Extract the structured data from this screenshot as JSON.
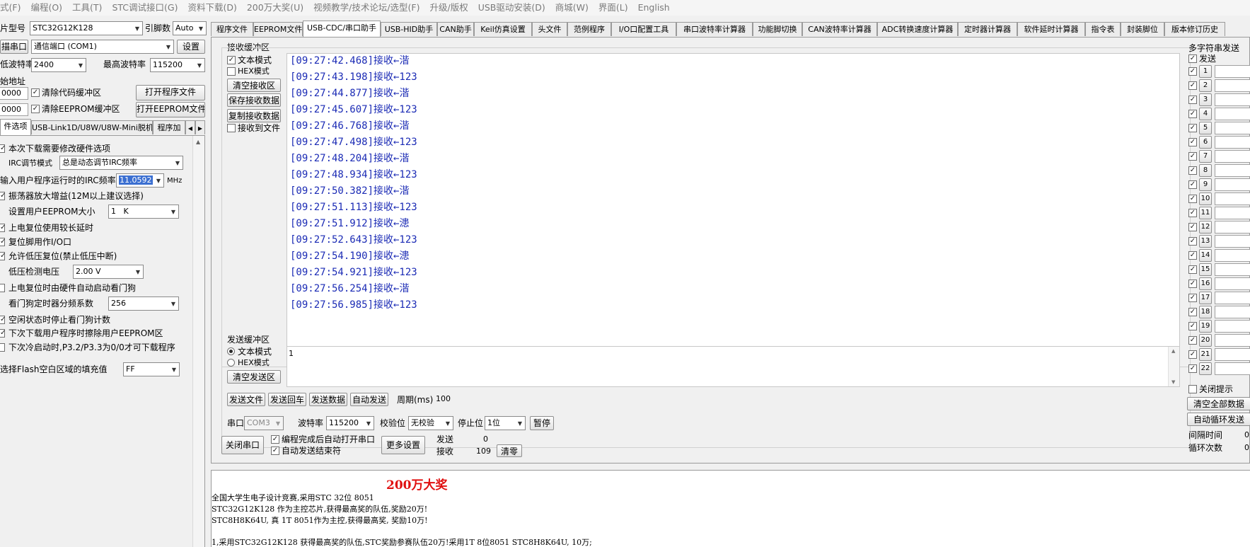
{
  "menu": [
    "式(F)",
    "编程(O)",
    "工具(T)",
    "STC调试接口(G)",
    "资料下载(D)",
    "200万大奖(U)",
    "视频教学/技术论坛/选型(F)",
    "升级/版权",
    "USB驱动安装(D)",
    "商城(W)",
    "界面(L)",
    "English"
  ],
  "left": {
    "chip_label": "片型号",
    "chip_value": "STC32G12K128",
    "pins_label": "引脚数",
    "pins_value": "Auto",
    "port_button": "描串口",
    "port_value": "通信端口 (COM1)",
    "settings_button": "设置",
    "min_baud_label": "低波特率",
    "min_baud_value": "2400",
    "max_baud_label": "最高波特率",
    "max_baud_value": "115200",
    "start_addr_label": "始地址",
    "addr1_value": "0000",
    "clear_code_label": "清除代码缓冲区",
    "open_program_button": "打开程序文件",
    "addr2_value": "0000",
    "clear_eeprom_label": "清除EEPROM缓冲区",
    "open_eeprom_button": "打开EEPROM文件",
    "tabs": [
      "件选项",
      "USB-Link1D/U8W/U8W-Mini脱机",
      "程序加"
    ],
    "hw": {
      "opt1": "本次下载需要修改硬件选项",
      "irc_mode_label": "IRC调节模式",
      "irc_mode_value": "总是动态调节IRC频率",
      "irc_freq_label": "输入用户程序运行时的IRC频率",
      "irc_freq_value": "11.0592",
      "irc_freq_unit": "MHz",
      "osc_gain": "振荡器放大增益(12M以上建议选择)",
      "eeprom_size_label": "设置用户EEPROM大小",
      "eeprom_size_value": "1   K",
      "opt_long_delay": "上电复位使用较长延时",
      "opt_reset_io": "复位脚用作I/O口",
      "opt_lvr": "允许低压复位(禁止低压中断)",
      "lvd_label": "低压检测电压",
      "lvd_value": "2.00 V",
      "opt_wdt_hw": "上电复位时由硬件自动启动看门狗",
      "wdt_div_label": "看门狗定时器分频系数",
      "wdt_div_value": "256",
      "opt_idle_wdt": "空闲状态时停止看门狗计数",
      "opt_erase_eeprom": "下次下载用户程序时擦除用户EEPROM区",
      "opt_cold_boot": "下次冷启动时,P3.2/P3.3为0/0才可下载程序",
      "flash_fill_label": "选择Flash空白区域的填充值",
      "flash_fill_value": "FF"
    }
  },
  "main_tabs": [
    "程序文件",
    "EEPROM文件",
    "USB-CDC/串口助手",
    "USB-HID助手",
    "CAN助手",
    "Keil仿真设置",
    "头文件",
    "范例程序",
    "I/O口配置工具",
    "串口波特率计算器",
    "功能脚切换",
    "CAN波特率计算器",
    "ADC转换速度计算器",
    "定时器计算器",
    "软件延时计算器",
    "指令表",
    "封装脚位",
    "版本修订历史"
  ],
  "recv": {
    "title": "接收缓冲区",
    "text_mode": "文本模式",
    "hex_mode": "HEX模式",
    "clear_button": "清空接收区",
    "save_button": "保存接收数据",
    "copy_button": "复制接收数据",
    "to_file": "接收到文件",
    "lines": [
      "[09:27:42.468]接收←湝",
      "[09:27:43.198]接收←123",
      "[09:27:44.877]接收←湝",
      "[09:27:45.607]接收←123",
      "[09:27:46.768]接收←湝",
      "[09:27:47.498]接收←123",
      "[09:27:48.204]接收←湝",
      "[09:27:48.934]接收←123",
      "[09:27:50.382]接收←湝",
      "[09:27:51.113]接收←123",
      "[09:27:51.912]接收←漶",
      "[09:27:52.643]接收←123",
      "[09:27:54.190]接收←漶",
      "[09:27:54.921]接收←123",
      "[09:27:56.254]接收←湝",
      "[09:27:56.985]接收←123"
    ]
  },
  "send": {
    "title": "发送缓冲区",
    "text_mode": "文本模式",
    "hex_mode": "HEX模式",
    "clear_button": "清空发送区",
    "content": "1",
    "send_file_button": "发送文件",
    "send_return_button": "发送回车",
    "send_data_button": "发送数据",
    "auto_send_button": "自动发送",
    "period_label": "周期(ms)",
    "period_value": "100"
  },
  "serial": {
    "port_label": "串口",
    "port_value": "COM3",
    "baud_label": "波特率",
    "baud_value": "115200",
    "parity_label": "校验位",
    "parity_value": "无校验",
    "stop_label": "停止位",
    "stop_value": "1位",
    "pause_button": "暂停",
    "close_button": "关闭串口",
    "auto_open": "编程完成后自动打开串口",
    "auto_end": "自动发送结束符",
    "more_button": "更多设置",
    "sent_label": "发送",
    "sent_value": "0",
    "recv_label": "接收",
    "recv_value": "109",
    "zero_button": "清零"
  },
  "multi": {
    "title": "多字符串发送",
    "send_header": "发送",
    "rows": [
      "1",
      "2",
      "3",
      "4",
      "5",
      "6",
      "7",
      "8",
      "9",
      "10",
      "11",
      "12",
      "13",
      "14",
      "15",
      "16",
      "17",
      "18",
      "19",
      "20",
      "21",
      "22"
    ],
    "close_hint": "关闭提示",
    "clear_all_button": "清空全部数据",
    "auto_loop_button": "自动循环发送",
    "interval_label": "间隔时间",
    "interval_value": "0",
    "loop_label": "循环次数",
    "loop_value": "0"
  },
  "news": {
    "heading": "200万大奖",
    "line1": "全国大学生电子设计竞赛,采用STC 32位 8051",
    "line2": "STC32G12K128 作为主控芯片,获得最高奖的队伍,奖励20万!",
    "line3": "STC8H8K64U, 真 1T 8051作为主控,获得最高奖,  奖励10万!",
    "line4": "1,采用STC32G12K128 获得最高奖的队伍,STC奖励参赛队伍20万!采用1T 8位8051 STC8H8K64U, 10万;"
  },
  "colors": {
    "recv_text": "#1b2bb5",
    "news_heading": "#e01010",
    "selection": "#3b6fd1"
  }
}
